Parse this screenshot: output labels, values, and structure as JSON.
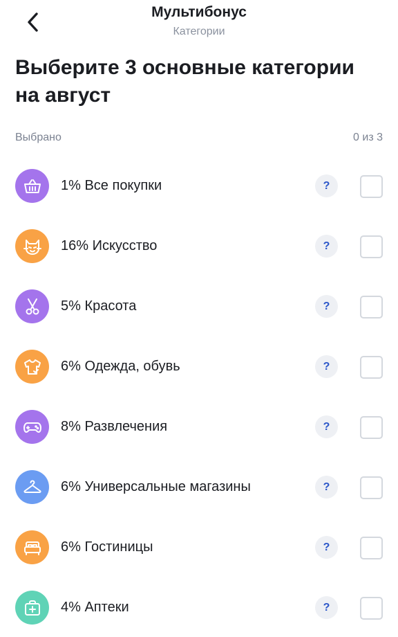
{
  "header": {
    "title": "Мультибонус",
    "subtitle": "Категории"
  },
  "heading": "Выберите 3 основные категории на август",
  "selection": {
    "label": "Выбрано",
    "count": "0 из 3"
  },
  "help_label": "?",
  "colors": {
    "purple": "#a474ec",
    "orange": "#f9a245",
    "blue": "#6b9cf2",
    "teal": "#5fd3b6",
    "help_text": "#2c57c9"
  },
  "categories": [
    {
      "label": "1% Все покупки",
      "icon": "basket-icon",
      "color": "#a474ec",
      "checked": false
    },
    {
      "label": "16% Искусство",
      "icon": "cat-mask-icon",
      "color": "#f9a245",
      "checked": false
    },
    {
      "label": "5% Красота",
      "icon": "scissors-icon",
      "color": "#a474ec",
      "checked": false
    },
    {
      "label": "6% Одежда, обувь",
      "icon": "tshirt-icon",
      "color": "#f9a245",
      "checked": false
    },
    {
      "label": "8% Развлечения",
      "icon": "gamepad-icon",
      "color": "#a474ec",
      "checked": false
    },
    {
      "label": "6% Универсальные магазины",
      "icon": "hanger-icon",
      "color": "#6b9cf2",
      "checked": false
    },
    {
      "label": "6% Гостиницы",
      "icon": "bed-icon",
      "color": "#f9a245",
      "checked": false
    },
    {
      "label": "4% Аптеки",
      "icon": "first-aid-icon",
      "color": "#5fd3b6",
      "checked": false
    }
  ]
}
